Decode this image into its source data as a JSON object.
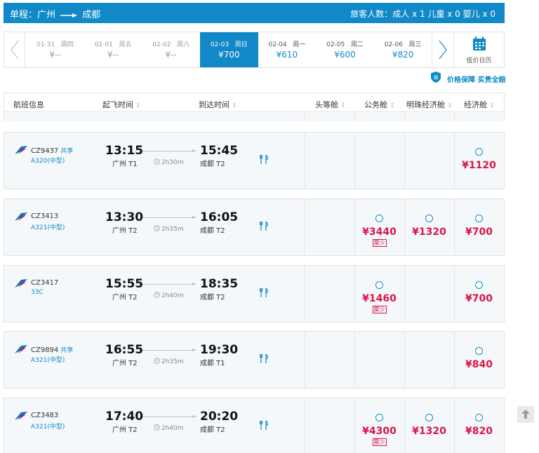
{
  "header": {
    "route_prefix": "单程：广州",
    "route_dest": "成都",
    "passengers": "旅客人数：成人 x 1 儿童 x 0 婴儿 x 0"
  },
  "date_bar": {
    "days": [
      {
        "date": "01-31",
        "weekday": "周四",
        "price": "¥--"
      },
      {
        "date": "02-01",
        "weekday": "周五",
        "price": "¥--"
      },
      {
        "date": "02-02",
        "weekday": "周六",
        "price": "¥--"
      },
      {
        "date": "02-03",
        "weekday": "周日",
        "price": "¥700"
      },
      {
        "date": "02-04",
        "weekday": "周一",
        "price": "¥610"
      },
      {
        "date": "02-05",
        "weekday": "周二",
        "price": "¥600"
      },
      {
        "date": "02-06",
        "weekday": "周三",
        "price": "¥820"
      }
    ],
    "selected_index": 3,
    "calendar_label": "低价日历"
  },
  "guarantee": "价格保障 买贵全赔",
  "table_header": {
    "flight_info": "航班信息",
    "depart_time": "起飞时间",
    "arrive_time": "到达时间",
    "first_class": "头等舱",
    "business_class": "公务舱",
    "pearl_economy": "明珠经济舱",
    "economy": "经济舱"
  },
  "flights": [
    {
      "flight_no": "CZ9437",
      "share": "共享",
      "aircraft": "A320(中型)",
      "depart": "13:15",
      "depart_airport": "广州 T1",
      "duration": "2h30m",
      "arrive": "15:45",
      "arrive_airport": "成都 T2",
      "fares": {
        "economy": {
          "price": "¥1120"
        }
      }
    },
    {
      "flight_no": "CZ3413",
      "share": "",
      "aircraft": "A321(中型)",
      "depart": "13:30",
      "depart_airport": "广州 T2",
      "duration": "2h35m",
      "arrive": "16:05",
      "arrive_airport": "成都 T2",
      "fares": {
        "business": {
          "price": "¥3440",
          "badge": "票少"
        },
        "pearl": {
          "price": "¥1320"
        },
        "economy": {
          "price": "¥700"
        }
      }
    },
    {
      "flight_no": "CZ3417",
      "share": "",
      "aircraft": "33C",
      "depart": "15:55",
      "depart_airport": "广州 T2",
      "duration": "2h40m",
      "arrive": "18:35",
      "arrive_airport": "成都 T2",
      "fares": {
        "business": {
          "price": "¥1460",
          "badge": "票少"
        },
        "economy": {
          "price": "¥700"
        }
      }
    },
    {
      "flight_no": "CZ9894",
      "share": "共享",
      "aircraft": "A321(中型)",
      "depart": "16:55",
      "depart_airport": "广州 T2",
      "duration": "2h35m",
      "arrive": "19:30",
      "arrive_airport": "成都 T1",
      "fares": {
        "economy": {
          "price": "¥840"
        }
      }
    },
    {
      "flight_no": "CZ3483",
      "share": "",
      "aircraft": "A321(中型)",
      "depart": "17:40",
      "depart_airport": "广州 T2",
      "duration": "2h40m",
      "arrive": "20:20",
      "arrive_airport": "成都 T2",
      "fares": {
        "business": {
          "price": "¥4300",
          "badge": "票少"
        },
        "pearl": {
          "price": "¥1320"
        },
        "economy": {
          "price": "¥820"
        }
      }
    }
  ],
  "colors": {
    "brand": "#1189c8",
    "price": "#d8174b",
    "row_bg": "#f5f8fb"
  },
  "icons": {
    "meal": "cutlery-icon",
    "airline": "china-southern-logo-icon",
    "calendar": "calendar-icon",
    "back_to_top": "arrow-up-icon"
  }
}
